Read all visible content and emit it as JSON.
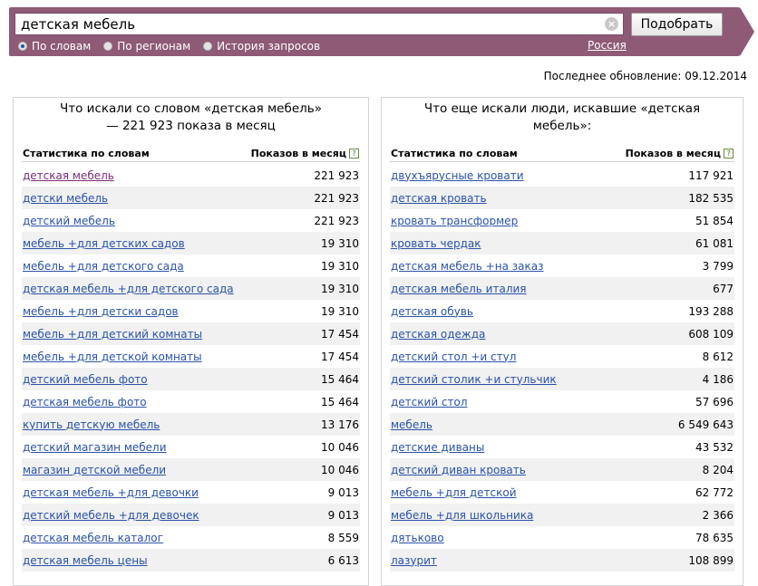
{
  "search": {
    "query": "детская мебель",
    "submit_label": "Подобрать",
    "clear_glyph": "×",
    "modes": [
      {
        "label": "По словам",
        "selected": true
      },
      {
        "label": "По регионам",
        "selected": false
      },
      {
        "label": "История запросов",
        "selected": false
      }
    ],
    "region": "Россия"
  },
  "updated": "Последнее обновление: 09.12.2014",
  "left": {
    "title": "Что искали со словом «детская мебель» — 221 923 показа в месяц",
    "col_phrase": "Статистика по словам",
    "col_count": "Показов в месяц",
    "rows": [
      {
        "phrase": "детская мебель",
        "count": "221 923"
      },
      {
        "phrase": "детски мебель",
        "count": "221 923"
      },
      {
        "phrase": "детский мебель",
        "count": "221 923"
      },
      {
        "phrase": "мебель +для детских садов",
        "count": "19 310"
      },
      {
        "phrase": "мебель +для детского сада",
        "count": "19 310"
      },
      {
        "phrase": "детская мебель +для детского сада",
        "count": "19 310"
      },
      {
        "phrase": "мебель +для детски садов",
        "count": "19 310"
      },
      {
        "phrase": "мебель +для детский комнаты",
        "count": "17 454"
      },
      {
        "phrase": "мебель +для детской комнаты",
        "count": "17 454"
      },
      {
        "phrase": "детский мебель фото",
        "count": "15 464"
      },
      {
        "phrase": "детская мебель фото",
        "count": "15 464"
      },
      {
        "phrase": "купить детскую мебель",
        "count": "13 176"
      },
      {
        "phrase": "детский магазин мебели",
        "count": "10 046"
      },
      {
        "phrase": "магазин детской мебели",
        "count": "10 046"
      },
      {
        "phrase": "детская мебель +для девочки",
        "count": "9 013"
      },
      {
        "phrase": "детский мебель +для девочек",
        "count": "9 013"
      },
      {
        "phrase": "детская мебель каталог",
        "count": "8 559"
      },
      {
        "phrase": "детская мебель цены",
        "count": "6 613"
      }
    ]
  },
  "right": {
    "title": "Что еще искали люди, искавшие «детская мебель»:",
    "col_phrase": "Статистика по словам",
    "col_count": "Показов в месяц",
    "rows": [
      {
        "phrase": "двухъярусные кровати",
        "count": "117 921"
      },
      {
        "phrase": "детская кровать",
        "count": "182 535"
      },
      {
        "phrase": "кровать трансформер",
        "count": "51 854"
      },
      {
        "phrase": "кровать чердак",
        "count": "61 081"
      },
      {
        "phrase": "детская мебель +на заказ",
        "count": "3 799"
      },
      {
        "phrase": "детская мебель италия",
        "count": "677"
      },
      {
        "phrase": "детская обувь",
        "count": "193 288"
      },
      {
        "phrase": "детская одежда",
        "count": "608 109"
      },
      {
        "phrase": "детский стол +и стул",
        "count": "8 612"
      },
      {
        "phrase": "детский столик +и стульчик",
        "count": "4 186"
      },
      {
        "phrase": "детский стол",
        "count": "57 696"
      },
      {
        "phrase": "мебель",
        "count": "6 549 643"
      },
      {
        "phrase": "детские диваны",
        "count": "43 532"
      },
      {
        "phrase": "детский диван кровать",
        "count": "8 204"
      },
      {
        "phrase": "мебель +для детской",
        "count": "62 772"
      },
      {
        "phrase": "мебель +для школьника",
        "count": "2 366"
      },
      {
        "phrase": "дятьково",
        "count": "78 635"
      },
      {
        "phrase": "лазурит",
        "count": "108 899"
      }
    ]
  }
}
